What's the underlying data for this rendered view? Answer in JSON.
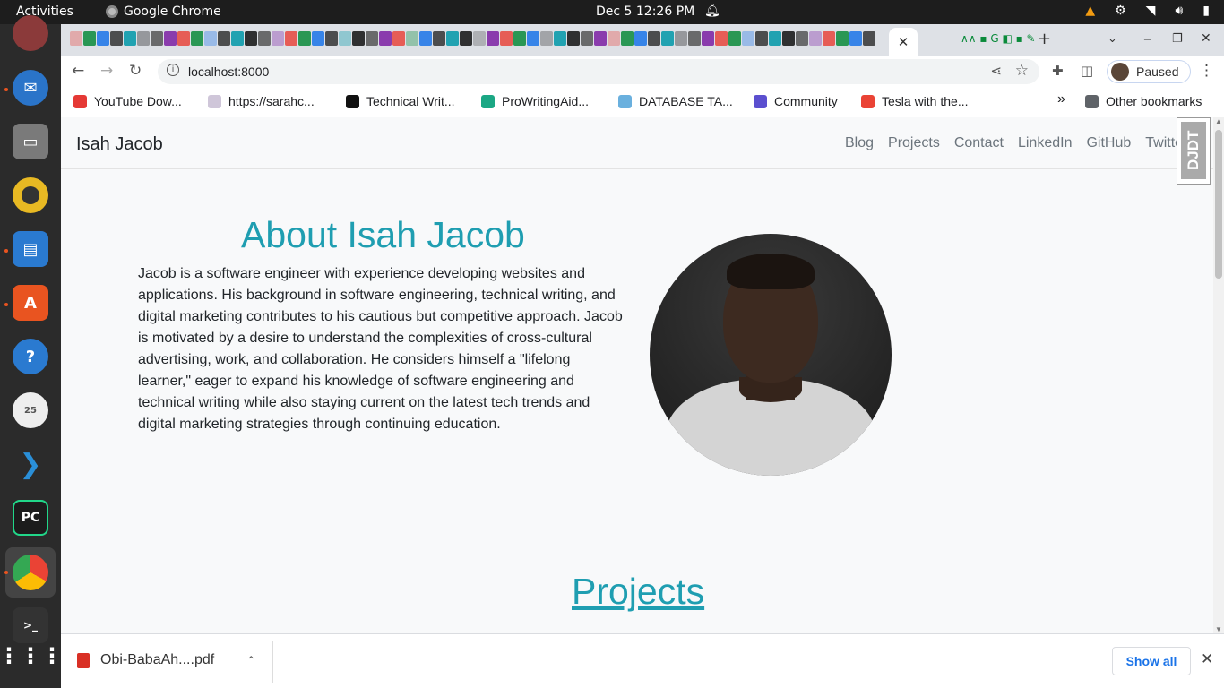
{
  "topbar": {
    "activities": "Activities",
    "app_name": "Google Chrome",
    "clock": "Dec 5  12:26 PM"
  },
  "dock": {
    "items": [
      "thunderbird-icon",
      "files-icon",
      "rhythmbox-icon",
      "writer-icon",
      "app-center-icon",
      "help-icon",
      "egg-timer-icon",
      "vscode-icon",
      "pycharm-icon",
      "chrome-icon",
      "terminal-icon",
      "app-grid-icon"
    ]
  },
  "browser": {
    "url": "localhost:8000",
    "profile_status": "Paused",
    "bookmarks": [
      {
        "label": "YouTube Dow...",
        "color": "#e53935"
      },
      {
        "label": "https://sarahc...",
        "color": "#cfc6d9"
      },
      {
        "label": "Technical Writ...",
        "color": "#111111"
      },
      {
        "label": "ProWritingAid...",
        "color": "#1ba784"
      },
      {
        "label": "DATABASE TA...",
        "color": "#6ab0de"
      },
      {
        "label": "Community",
        "color": "#5b4fcf"
      },
      {
        "label": "Tesla with the...",
        "color": "#ea4335"
      }
    ],
    "other_bookmarks": "Other bookmarks",
    "overflow": "»"
  },
  "site": {
    "brand": "Isah Jacob",
    "nav": [
      "Blog",
      "Projects",
      "Contact",
      "LinkedIn",
      "GitHub",
      "Twitter"
    ],
    "debug_toolbar": "DJDT",
    "about_title": "About Isah Jacob",
    "about_text": "Jacob is a software engineer with experience developing websites and applications. His background in software engineering, technical writing, and digital marketing contributes to his cautious but competitive approach. Jacob is motivated by a desire to understand the complexities of cross-cultural advertising, work, and collaboration. He considers himself a \"lifelong learner,\" eager to expand his knowledge of software engineering and technical writing while also staying current on the latest tech trends and digital marketing strategies through continuing education.",
    "projects_title": "Projects"
  },
  "downloads": {
    "file": "Obi-BabaAh....pdf",
    "show_all": "Show all"
  },
  "colors": {
    "accent": "#1f9eb1",
    "topbar": "#1d1d1d",
    "dock": "#2b2b2b",
    "tabstrip": "#dee1e6"
  }
}
